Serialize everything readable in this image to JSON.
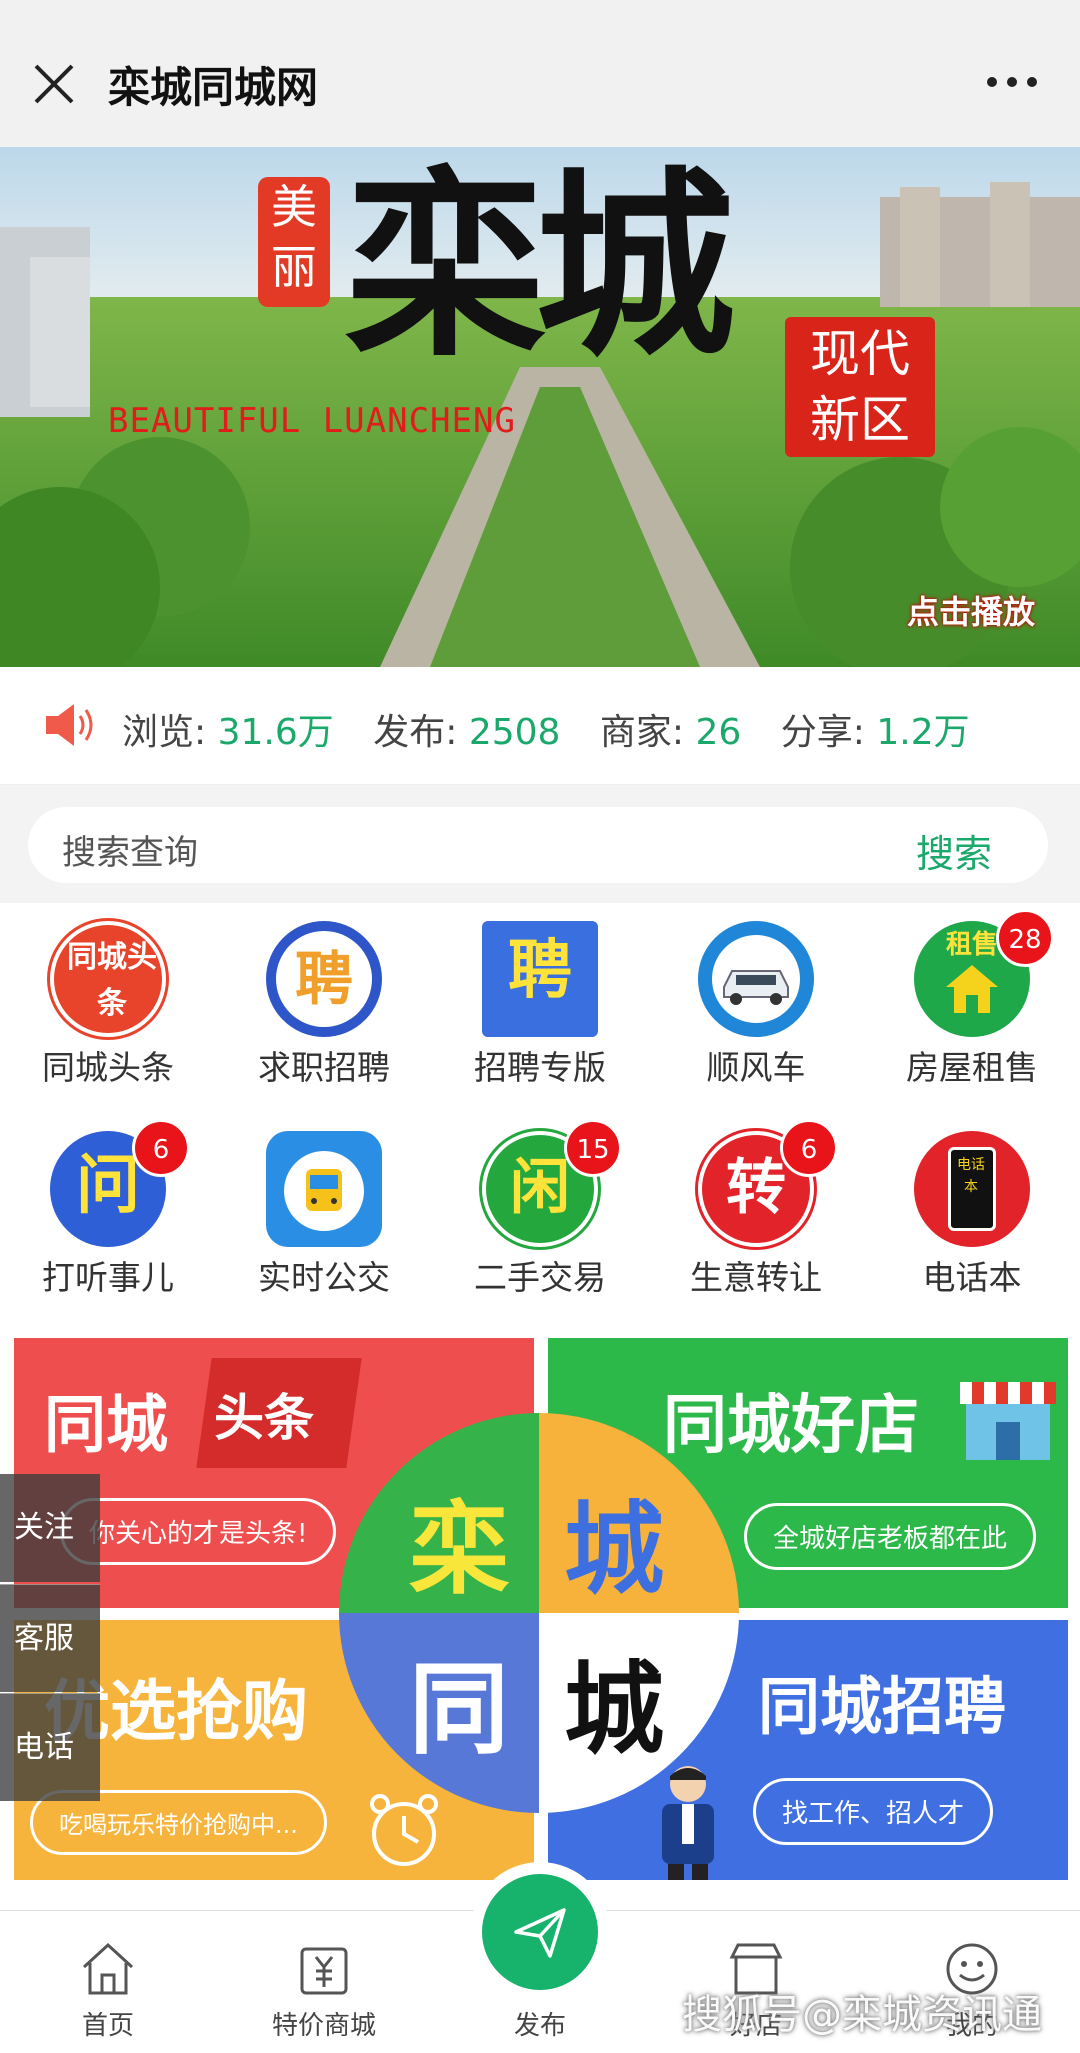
{
  "topbar": {
    "title": "栾城同城网"
  },
  "banner": {
    "meili": "美丽",
    "main_title": "栾城",
    "subtitle_en": "BEAUTIFUL LUANCHENG",
    "tag": "现代新区",
    "tag_line1": "现代",
    "tag_line2": "新区",
    "play": "点击播放"
  },
  "stats": {
    "views_label": "浏览:",
    "views_value": "31.6万",
    "posts_label": "发布:",
    "posts_value": "2508",
    "shops_label": "商家:",
    "shops_value": "26",
    "shares_label": "分享:",
    "shares_value": "1.2万"
  },
  "search": {
    "placeholder": "搜索查询",
    "button": "搜索"
  },
  "grid": {
    "items": [
      {
        "label": "同城头条",
        "icon": "tongcheng-toutiao-icon",
        "glyph": "同城头条"
      },
      {
        "label": "求职招聘",
        "icon": "job-search-icon",
        "glyph": "聘"
      },
      {
        "label": "招聘专版",
        "icon": "recruit-board-icon",
        "glyph": "聘"
      },
      {
        "label": "顺风车",
        "icon": "car-icon"
      },
      {
        "label": "房屋租售",
        "icon": "house-icon",
        "glyph": "租售",
        "badge": "28"
      },
      {
        "label": "打听事儿",
        "icon": "ask-icon",
        "glyph": "问",
        "badge": "6"
      },
      {
        "label": "实时公交",
        "icon": "bus-icon"
      },
      {
        "label": "二手交易",
        "icon": "secondhand-icon",
        "glyph": "闲",
        "badge": "15"
      },
      {
        "label": "生意转让",
        "icon": "transfer-icon",
        "glyph": "转",
        "badge": "6"
      },
      {
        "label": "电话本",
        "icon": "phonebook-icon",
        "glyph": "电话本"
      }
    ]
  },
  "promo": {
    "t1_title_a": "同城",
    "t1_title_b": "头条",
    "t1_pill": "你关心的才是头条!",
    "t2_title": "同城好店",
    "t2_pill": "全城好店老板都在此",
    "t3_title": "优选抢购",
    "t3_pill": "吃喝玩乐特价抢购中...",
    "t4_title": "同城招聘",
    "t4_pill": "找工作、招人才",
    "center": [
      "栾",
      "城",
      "同",
      "城"
    ]
  },
  "side": {
    "follow": "关注",
    "service": "客服",
    "phone": "电话"
  },
  "bottomnav": {
    "home": "首页",
    "mall": "特价商城",
    "publish": "发布",
    "shop": "好店",
    "mine": "我的"
  },
  "watermark": "搜狐号@栾城资讯通",
  "colors": {
    "accent": "#1aa96b",
    "badge": "#e8141a"
  }
}
